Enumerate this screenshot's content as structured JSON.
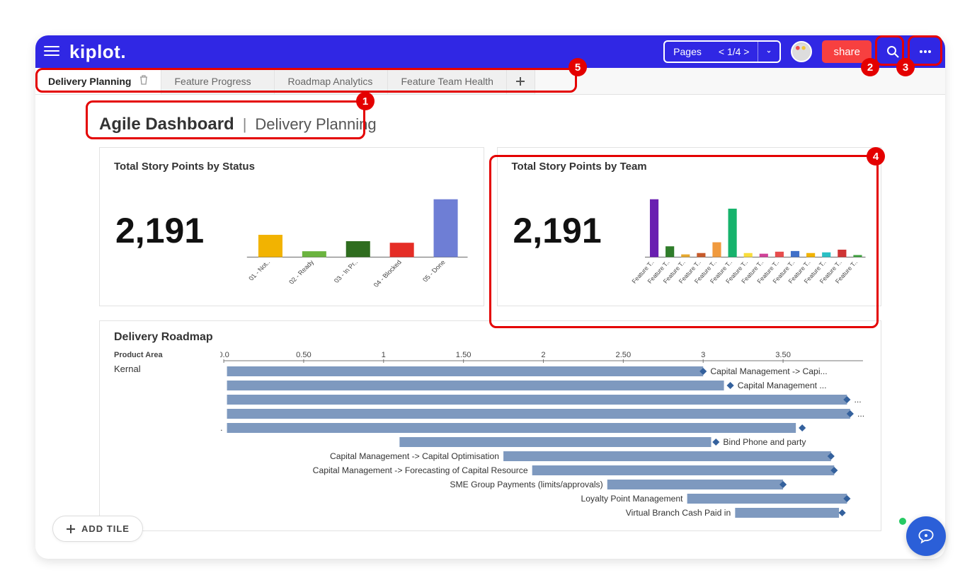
{
  "topbar": {
    "logo": "kiplot.",
    "pages_label": "Pages",
    "pages_counter": "< 1/4 >",
    "share_label": "share"
  },
  "tabs": [
    {
      "label": "Delivery Planning",
      "active": true
    },
    {
      "label": "Feature Progress",
      "active": false
    },
    {
      "label": "Roadmap Analytics",
      "active": false
    },
    {
      "label": "Feature Team Health",
      "active": false
    }
  ],
  "page_title": {
    "main": "Agile Dashboard",
    "sub": "Delivery Planning"
  },
  "card_status": {
    "title": "Total Story Points by Status",
    "value": "2,191"
  },
  "card_team": {
    "title": "Total Story Points by Team",
    "value": "2,191"
  },
  "roadmap": {
    "title": "Delivery Roadmap",
    "column_header": "Product Area",
    "group": "Kernal"
  },
  "add_tile": "ADD TILE",
  "annotations": {
    "1": "1",
    "2": "2",
    "3": "3",
    "4": "4",
    "5": "5"
  },
  "chart_data": [
    {
      "id": "status",
      "type": "bar",
      "title": "Total Story Points by Status",
      "total": 2191,
      "categories": [
        "01 - Not..",
        "02 - Ready",
        "03 - In Pr..",
        "04 - Blocked",
        "05 - Done"
      ],
      "values": [
        420,
        110,
        300,
        270,
        1091
      ],
      "colors": [
        "#f2b301",
        "#6bb43f",
        "#2f6d1f",
        "#e52d26",
        "#6e7ed5"
      ],
      "ylim": [
        0,
        1091
      ]
    },
    {
      "id": "team",
      "type": "bar",
      "title": "Total Story Points by Team",
      "total": 2191,
      "categories": [
        "Feature T..",
        "Feature T..",
        "Feature T..",
        "Feature T..",
        "Feature T..",
        "Feature T..",
        "Feature T..",
        "Feature T..",
        "Feature T..",
        "Feature T..",
        "Feature T..",
        "Feature T..",
        "Feature T..",
        "Feature T.."
      ],
      "values": [
        860,
        160,
        40,
        60,
        220,
        720,
        60,
        50,
        80,
        90,
        60,
        70,
        110,
        30
      ],
      "colors": [
        "#6a1fb1",
        "#2f7d2a",
        "#e7a92f",
        "#c75b2b",
        "#f09a3e",
        "#16b36c",
        "#f9dd3b",
        "#d04299",
        "#e84d4d",
        "#3f70c9",
        "#f2b301",
        "#2ac0c4",
        "#cf3434",
        "#3fa13f"
      ],
      "ylim": [
        0,
        860
      ]
    },
    {
      "id": "roadmap",
      "type": "gantt",
      "title": "Delivery Roadmap",
      "xlim": [
        0.0,
        4.0
      ],
      "ticks": [
        "0.0",
        "0.50",
        "1",
        "1.50",
        "2",
        "2.50",
        "3",
        "3.50"
      ],
      "rows": [
        {
          "start": 0.02,
          "end": 3.0,
          "marker": 3.0,
          "label": "Capital Management -> Capi...",
          "label_side": "right"
        },
        {
          "start": 0.02,
          "end": 3.13,
          "marker": 3.17,
          "label": "Capital Management ...",
          "label_side": "right"
        },
        {
          "start": 0.02,
          "end": 3.9,
          "marker": 3.9,
          "label": "...",
          "label_side": "right"
        },
        {
          "start": 0.02,
          "end": 3.92,
          "marker": 3.92,
          "label": "...",
          "label_side": "right"
        },
        {
          "start": 0.02,
          "end": 3.58,
          "marker": 3.62,
          "label": "Broker Manage...",
          "label_side": "left"
        },
        {
          "start": 1.1,
          "end": 3.05,
          "marker": 3.08,
          "label": "Bind Phone and party",
          "label_side": "right"
        },
        {
          "start": 1.75,
          "end": 3.8,
          "marker": 3.8,
          "label": "Capital Management -> Capital Optimisation",
          "label_side": "left"
        },
        {
          "start": 1.93,
          "end": 3.82,
          "marker": 3.82,
          "label": "Capital Management -> Forecasting of Capital Resource",
          "label_side": "left"
        },
        {
          "start": 2.4,
          "end": 3.5,
          "marker": 3.5,
          "label": "SME Group Payments (limits/approvals)",
          "label_side": "left"
        },
        {
          "start": 2.9,
          "end": 3.9,
          "marker": 3.9,
          "label": "Loyalty Point Management",
          "label_side": "left"
        },
        {
          "start": 3.2,
          "end": 3.85,
          "marker": 3.87,
          "label": "Virtual Branch Cash Paid in",
          "label_side": "left"
        }
      ]
    }
  ]
}
